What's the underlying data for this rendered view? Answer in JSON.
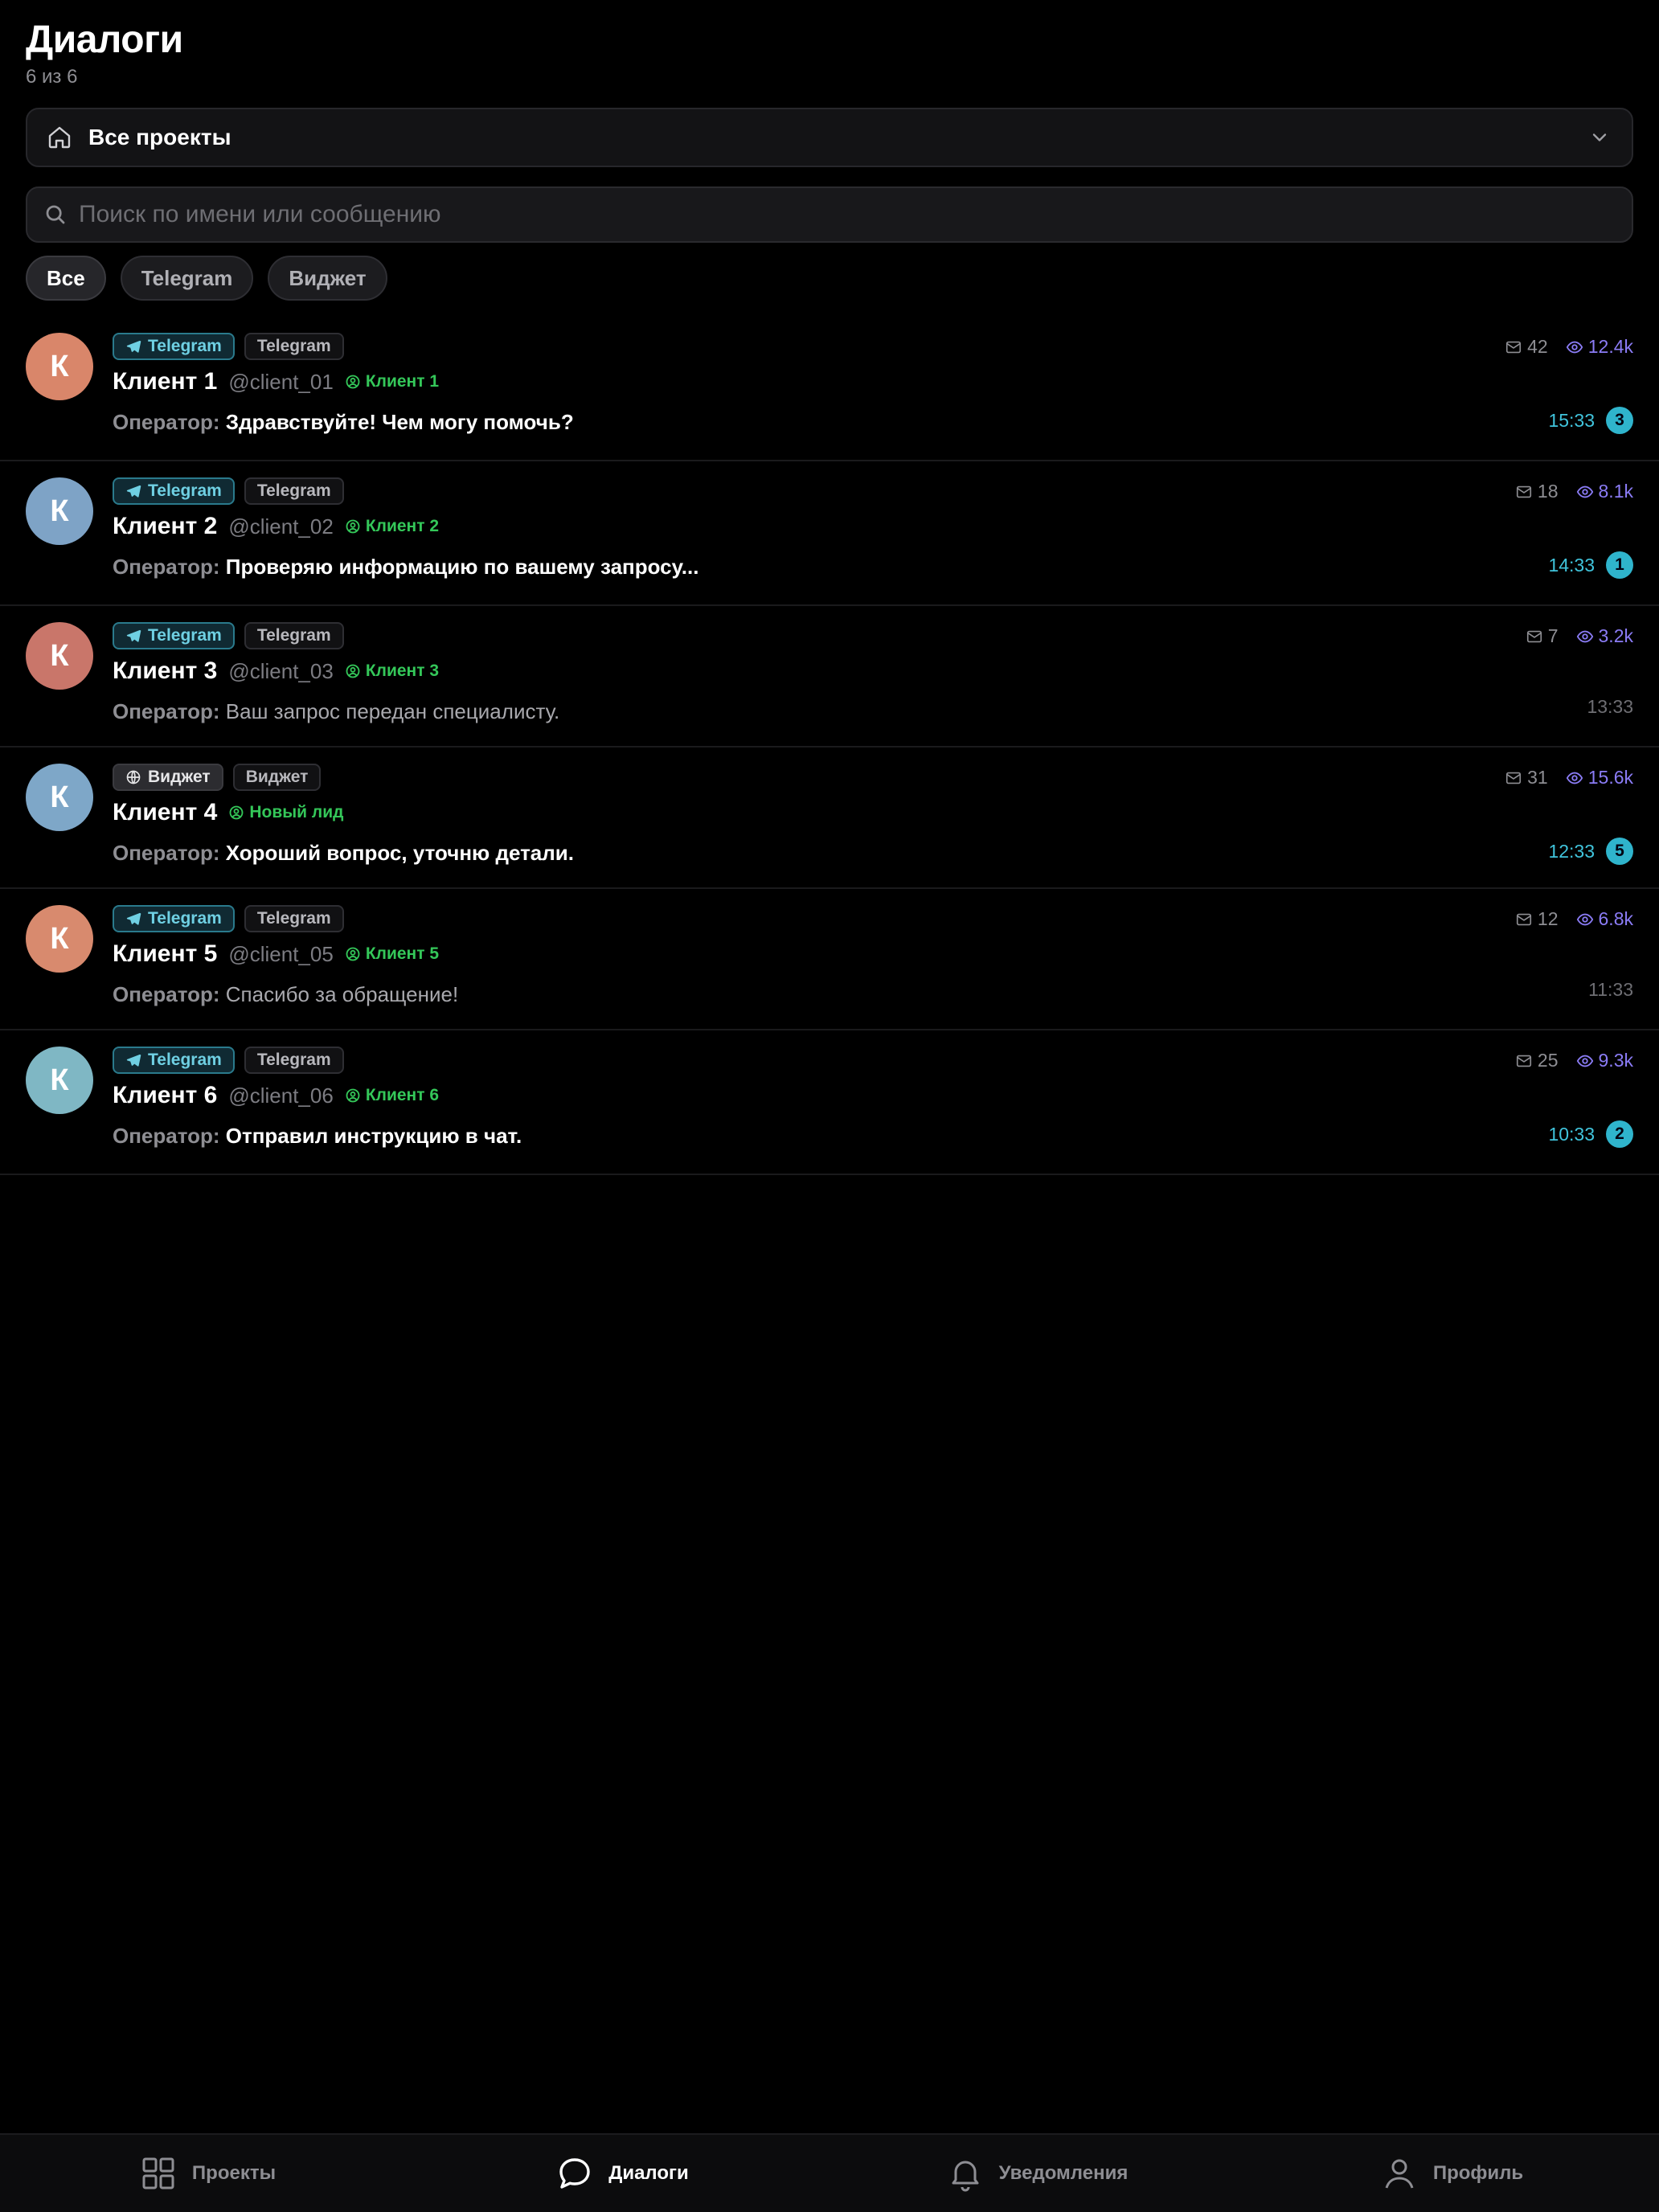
{
  "header": {
    "title": "Диалоги",
    "count": "6 из 6"
  },
  "project_select": {
    "label": "Все проекты",
    "icon": "home-icon"
  },
  "search": {
    "placeholder": "Поиск по имени или сообщению",
    "value": ""
  },
  "filters": [
    {
      "label": "Все",
      "active": true
    },
    {
      "label": "Telegram",
      "active": false
    },
    {
      "label": "Виджет",
      "active": false
    }
  ],
  "dialogs": [
    {
      "avatar_letter": "К",
      "avatar_color": "#d9866a",
      "source": "Telegram",
      "source_type": "telegram",
      "channel": "Telegram",
      "name": "Клиент 1",
      "handle": "@client_01",
      "lead": "Клиент 1",
      "operator_label": "Оператор:",
      "message": "Здравствуйте! Чем могу помочь?",
      "messages": "42",
      "views": "12.4k",
      "time": "15:33",
      "unread": "3"
    },
    {
      "avatar_letter": "К",
      "avatar_color": "#7ea3c6",
      "source": "Telegram",
      "source_type": "telegram",
      "channel": "Telegram",
      "name": "Клиент 2",
      "handle": "@client_02",
      "lead": "Клиент 2",
      "operator_label": "Оператор:",
      "message": "Проверяю информацию по вашему запросу...",
      "messages": "18",
      "views": "8.1k",
      "time": "14:33",
      "unread": "1"
    },
    {
      "avatar_letter": "К",
      "avatar_color": "#c9766a",
      "source": "Telegram",
      "source_type": "telegram",
      "channel": "Telegram",
      "name": "Клиент 3",
      "handle": "@client_03",
      "lead": "Клиент 3",
      "operator_label": "Оператор:",
      "message": "Ваш запрос передан специалисту.",
      "messages": "7",
      "views": "3.2k",
      "time": "13:33",
      "unread": ""
    },
    {
      "avatar_letter": "К",
      "avatar_color": "#7ea7c8",
      "source": "Виджет",
      "source_type": "widget",
      "channel": "Виджет",
      "name": "Клиент 4",
      "handle": "",
      "lead": "Новый лид",
      "operator_label": "Оператор:",
      "message": "Хороший вопрос, уточню детали.",
      "messages": "31",
      "views": "15.6k",
      "time": "12:33",
      "unread": "5"
    },
    {
      "avatar_letter": "К",
      "avatar_color": "#d88a6e",
      "source": "Telegram",
      "source_type": "telegram",
      "channel": "Telegram",
      "name": "Клиент 5",
      "handle": "@client_05",
      "lead": "Клиент 5",
      "operator_label": "Оператор:",
      "message": "Спасибо за обращение!",
      "messages": "12",
      "views": "6.8k",
      "time": "11:33",
      "unread": ""
    },
    {
      "avatar_letter": "К",
      "avatar_color": "#7fb7c4",
      "source": "Telegram",
      "source_type": "telegram",
      "channel": "Telegram",
      "name": "Клиент 6",
      "handle": "@client_06",
      "lead": "Клиент 6",
      "operator_label": "Оператор:",
      "message": "Отправил инструкцию в чат.",
      "messages": "25",
      "views": "9.3k",
      "time": "10:33",
      "unread": "2"
    }
  ],
  "nav": [
    {
      "label": "Проекты",
      "icon": "grid-icon",
      "active": false
    },
    {
      "label": "Диалоги",
      "icon": "chat-icon",
      "active": true
    },
    {
      "label": "Уведомления",
      "icon": "bell-icon",
      "active": false
    },
    {
      "label": "Профиль",
      "icon": "user-icon",
      "active": false
    }
  ],
  "colors": {
    "accent": "#2fb4cc",
    "lead_green": "#34c759",
    "views_purple": "#8b7cf6",
    "background": "#000000"
  }
}
